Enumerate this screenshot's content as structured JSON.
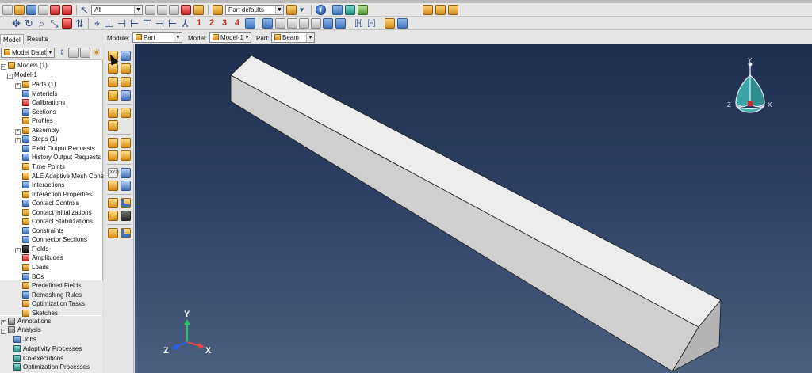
{
  "toolbar1": {
    "selection_filter": "All",
    "render_style": "Part defaults",
    "info_icon_letter": "i"
  },
  "toolbar2": {
    "layers": [
      "1",
      "2",
      "3",
      "4"
    ]
  },
  "tabs": [
    {
      "label": "Model",
      "active": true
    },
    {
      "label": "Results",
      "active": false
    }
  ],
  "context": {
    "module_label": "Module:",
    "module_value": "Part",
    "model_label": "Model:",
    "model_value": "Model-1",
    "part_label": "Part:",
    "part_value": "Beam"
  },
  "tree": {
    "database": "Model Database",
    "root": "Models (1)",
    "model": "Model-1",
    "items": [
      "Parts (1)",
      "Materials",
      "Calibrations",
      "Sections",
      "Profiles",
      "Assembly",
      "Steps (1)",
      "Field Output Requests",
      "History Output Requests",
      "Time Points",
      "ALE Adaptive Mesh Constra",
      "Interactions",
      "Interaction Properties",
      "Contact Controls",
      "Contact Initializations",
      "Contact Stabilizations",
      "Constraints",
      "Connector Sections",
      "Fields",
      "Amplitudes",
      "Loads",
      "BCs",
      "Predefined Fields",
      "Remeshing Rules",
      "Optimization Tasks",
      "Sketches"
    ],
    "annotations": "Annotations",
    "analysis": "Analysis",
    "analysis_items": [
      "Jobs",
      "Adaptivity Processes",
      "Co-executions",
      "Optimization Processes"
    ]
  },
  "triad": {
    "x": "X",
    "y": "Y",
    "z": "Z"
  },
  "view_cube": {
    "x": "X",
    "y": "Y",
    "z": "Z"
  },
  "colors": {
    "viewport_top": "#1f2f4f",
    "viewport_bottom": "#4b5f80",
    "part_face": "#e8e8e8"
  }
}
